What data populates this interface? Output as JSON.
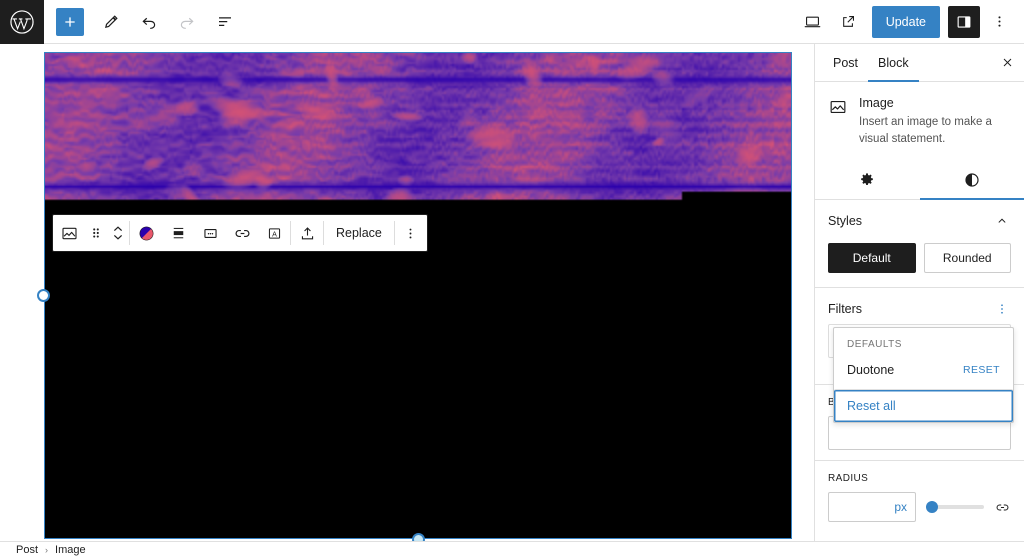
{
  "topbar": {
    "logo_icon": "wordpress-icon",
    "add_block_icon": "plus-icon",
    "add_block_label": "+",
    "tools_icon": "pencil-icon",
    "undo_icon": "undo-arrow-icon",
    "redo_icon": "redo-arrow-icon",
    "list_view_icon": "list-view-icon",
    "preview_icon": "desktop-icon",
    "view_post_icon": "external-link-icon",
    "update_label": "Update",
    "sidebar_toggle_icon": "sidebar-panel-icon",
    "more_icon": "vertical-ellipsis-icon"
  },
  "block_toolbar": {
    "block_type_icon": "image-icon",
    "drag_icon": "drag-dots-icon",
    "move_icon": "move-up-down-chevrons-icon",
    "duotone_icon": "duotone-circle-icon",
    "align_icon": "align-icon",
    "crop_icon": "crop-icon",
    "link_icon": "link-icon",
    "text_over_icon": "add-text-over-image-icon",
    "upload_icon": "upload-icon",
    "replace_label": "Replace",
    "more_icon": "vertical-ellipsis-icon"
  },
  "canvas": {
    "resize_handle_left_name": "left-resize-handle",
    "resize_handle_bottom_name": "bottom-resize-handle"
  },
  "sidebar": {
    "tabs": [
      {
        "label": "Post",
        "active": false
      },
      {
        "label": "Block",
        "active": true
      }
    ],
    "close_icon": "close-x-icon",
    "block_card": {
      "icon": "image-icon",
      "title": "Image",
      "description": "Insert an image to make a visual statement."
    },
    "inspector_tabs": [
      {
        "icon": "gear-icon",
        "active": false
      },
      {
        "icon": "contrast-half-circle-icon",
        "active": true
      }
    ],
    "styles_panel": {
      "title": "Styles",
      "collapse_icon": "chevron-up-icon",
      "options": [
        {
          "label": "Default",
          "active": true
        },
        {
          "label": "Rounded",
          "active": false
        }
      ]
    },
    "filters_panel": {
      "title": "Filters",
      "menu_icon": "vertical-ellipsis-icon"
    },
    "filters_dropdown": {
      "defaults_label": "DEFAULTS",
      "items": [
        {
          "label": "Duotone",
          "action_label": "RESET"
        }
      ],
      "reset_all_label": "Reset all"
    },
    "border_panel": {
      "title_visible_fragment": "B"
    },
    "radius_panel": {
      "label": "RADIUS",
      "value": "",
      "unit": "px",
      "slider_value": 0,
      "link_icon": "link-sides-icon"
    }
  },
  "bottombar": {
    "breadcrumbs": [
      "Post",
      "Image"
    ],
    "separator": "›"
  },
  "colors": {
    "accent": "#3582c4",
    "dark": "#1e1e1e",
    "border": "#e0e0e0",
    "duotone_shadow": "#2a00ad",
    "duotone_highlight": "#e8576b"
  }
}
